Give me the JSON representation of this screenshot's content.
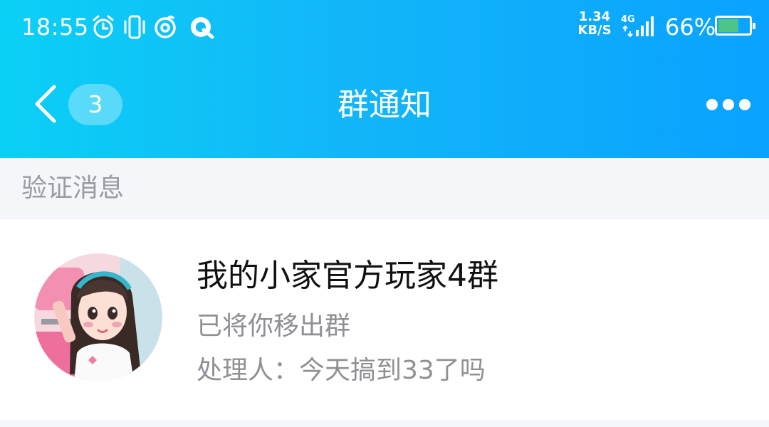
{
  "status_bar": {
    "time": "18:55",
    "net_speed_value": "1.34",
    "net_speed_unit": "KB/S",
    "network_type": "4G",
    "battery_percent": "66%",
    "battery_level": 0.66,
    "icons": [
      "alarm-icon",
      "vibrate-icon",
      "netease-music-icon",
      "qq-browser-icon",
      "signal-icon",
      "battery-icon"
    ]
  },
  "nav": {
    "back_icon": "chevron-left-icon",
    "unread_badge": "3",
    "title": "群通知",
    "more_icon": "more-dots-icon"
  },
  "section": {
    "label": "验证消息"
  },
  "notification": {
    "group_name": "我的小家官方玩家4群",
    "message": "已将你移出群",
    "handler": "处理人：今天搞到33了吗"
  },
  "colors": {
    "header_start": "#0bd0f6",
    "header_end": "#0aa2ff",
    "battery_fill": "#4ec38a",
    "secondary_text": "#8e9096"
  }
}
